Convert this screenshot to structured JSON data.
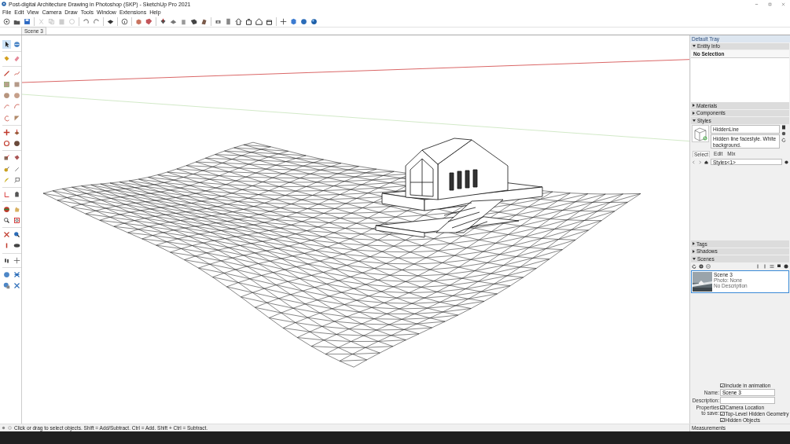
{
  "window": {
    "title": "Post-digital Architecture Drawing in Photoshop (SKP) - SketchUp Pro 2021"
  },
  "menu": [
    "File",
    "Edit",
    "View",
    "Camera",
    "Draw",
    "Tools",
    "Window",
    "Extensions",
    "Help"
  ],
  "scene_tabs": [
    {
      "label": "Scene 3",
      "selected": true
    }
  ],
  "tray": {
    "title": "Default Tray",
    "panels": [
      {
        "title": "Entity Info",
        "expanded": true,
        "kind": "entity",
        "text": "No Selection"
      },
      {
        "title": "Materials",
        "expanded": false
      },
      {
        "title": "Components",
        "expanded": false
      },
      {
        "title": "Styles",
        "expanded": true,
        "kind": "styles",
        "style_name": "HiddenLine",
        "description": "Hidden line facestyle. White background.",
        "tabs": [
          {
            "label": "Select",
            "selected": true
          },
          {
            "label": "Edit",
            "selected": false
          },
          {
            "label": "Mix",
            "selected": false
          }
        ],
        "collection": "Styles<1>"
      },
      {
        "title": "Tags",
        "expanded": false
      },
      {
        "title": "Shadows",
        "expanded": false
      },
      {
        "title": "Scenes",
        "expanded": true,
        "kind": "scenes",
        "scenes": [
          {
            "name": "Scene 3",
            "photo": "Photo: None",
            "description": "No Description",
            "selected": true
          }
        ],
        "include": {
          "label": "Include in animation",
          "checked": true
        },
        "fields": [
          {
            "label": "Name:",
            "value": "Scene 3"
          },
          {
            "label": "Description:"
          }
        ],
        "properties_label": "Properties to save:",
        "properties": [
          {
            "label": "Camera Location",
            "checked": true
          },
          {
            "label": "Top-Level Hidden Geometry",
            "checked": true
          },
          {
            "label": "Hidden Objects",
            "checked": true
          }
        ]
      }
    ]
  },
  "status_bar": {
    "hint": "Click or drag to select objects. Shift = Add/Subtract. Ctrl = Add. Shift + Ctrl = Subtract.",
    "measurements_label": "Measurements"
  }
}
